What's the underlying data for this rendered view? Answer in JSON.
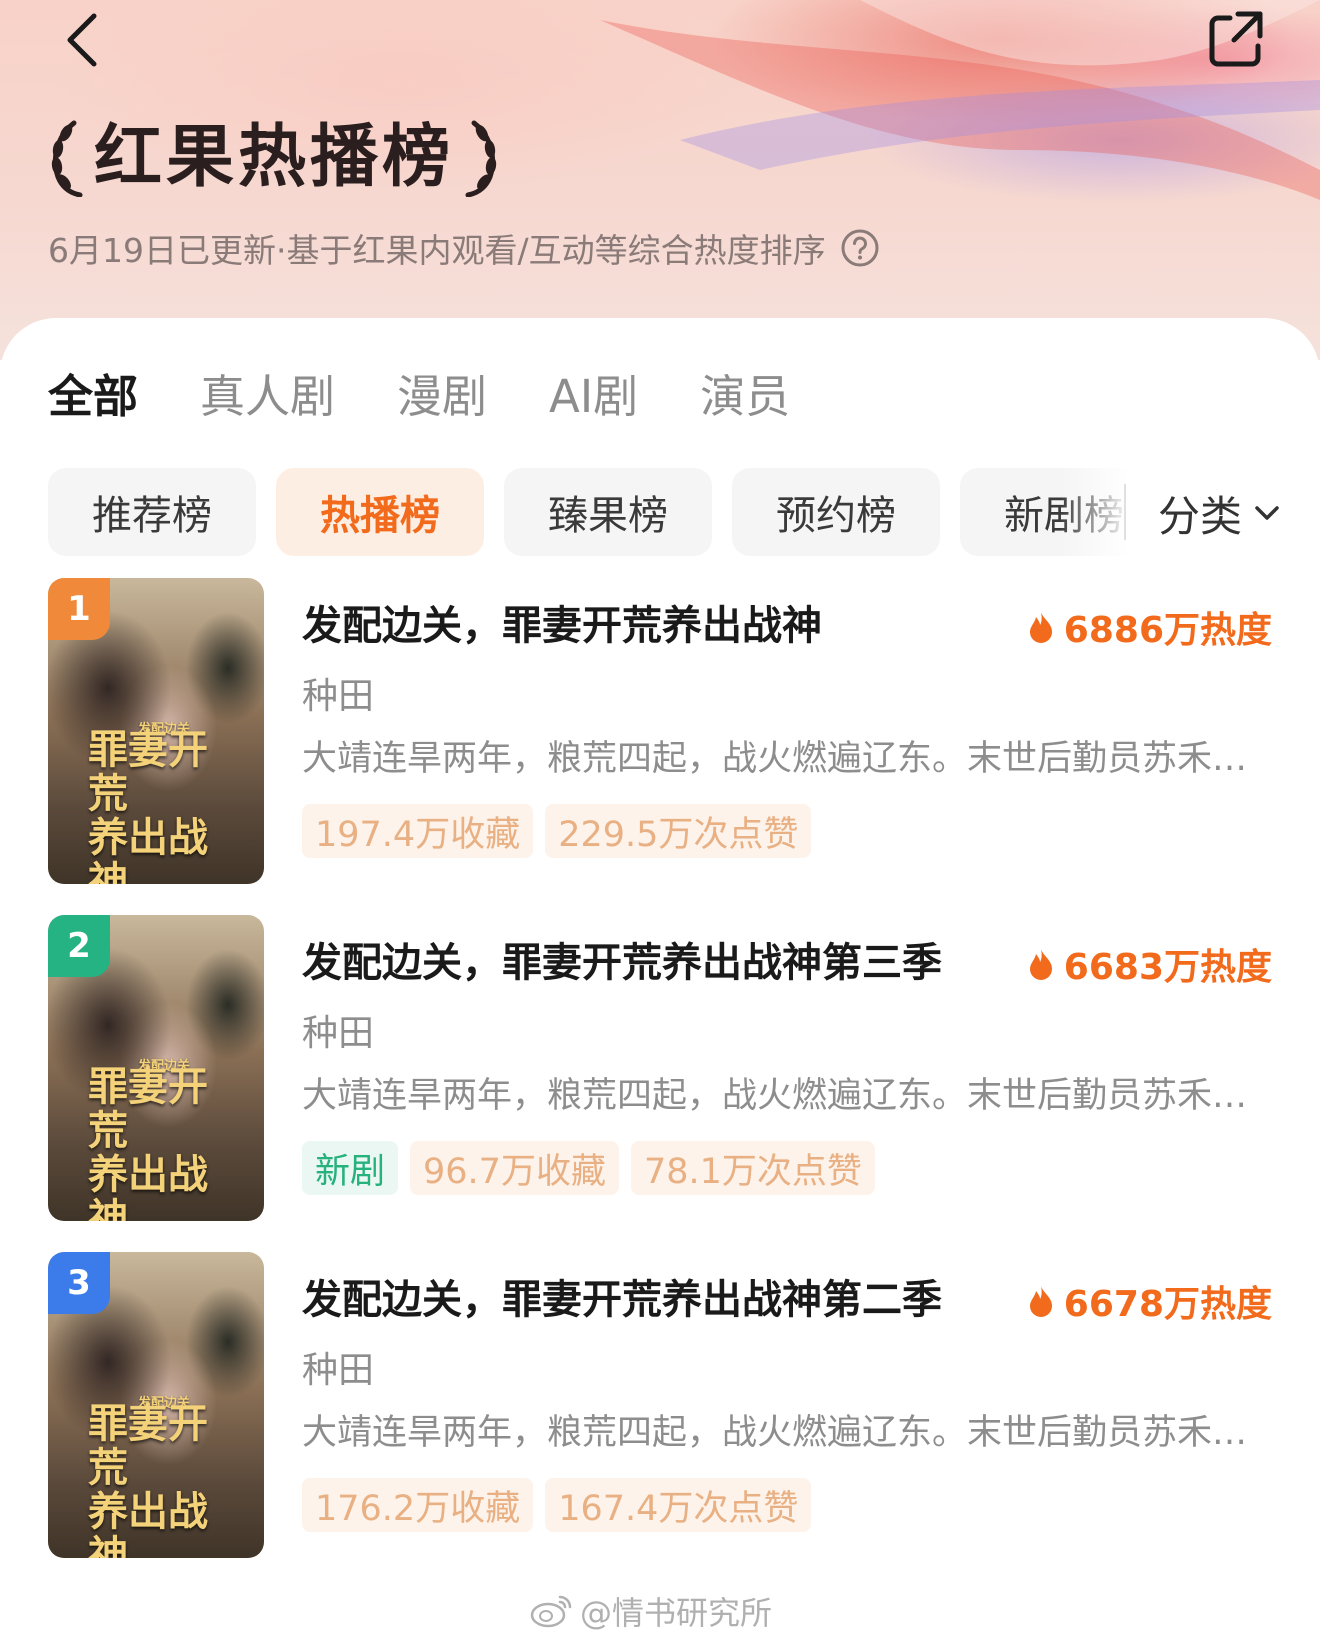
{
  "header": {
    "title": "红果热播榜",
    "subtitle": "6月19日已更新·基于红果内观看/互动等综合热度排序"
  },
  "main_tabs": [
    {
      "label": "全部",
      "active": true
    },
    {
      "label": "真人剧",
      "active": false
    },
    {
      "label": "漫剧",
      "active": false
    },
    {
      "label": "AI剧",
      "active": false
    },
    {
      "label": "演员",
      "active": false
    }
  ],
  "sub_tabs": [
    {
      "label": "推荐榜",
      "active": false
    },
    {
      "label": "热播榜",
      "active": true
    },
    {
      "label": "臻果榜",
      "active": false
    },
    {
      "label": "预约榜",
      "active": false
    },
    {
      "label": "新剧榜",
      "active": false
    }
  ],
  "category": {
    "label": "分类"
  },
  "dramas": [
    {
      "rank": "1",
      "rank_color": "#f08a3a",
      "title": "发配边关，罪妻开荒养出战神",
      "heat": "6886万热度",
      "genre": "种田",
      "description": "大靖连旱两年，粮荒四起，战火燃遍辽东。末世后勤员苏禾…",
      "tags": [
        {
          "text": "197.4万收藏",
          "kind": "stat"
        },
        {
          "text": "229.5万次点赞",
          "kind": "stat"
        }
      ]
    },
    {
      "rank": "2",
      "rank_color": "#25b383",
      "title": "发配边关，罪妻开荒养出战神第三季",
      "heat": "6683万热度",
      "genre": "种田",
      "description": "大靖连旱两年，粮荒四起，战火燃遍辽东。末世后勤员苏禾…",
      "tags": [
        {
          "text": "新剧",
          "kind": "new"
        },
        {
          "text": "96.7万收藏",
          "kind": "stat"
        },
        {
          "text": "78.1万次点赞",
          "kind": "stat"
        }
      ]
    },
    {
      "rank": "3",
      "rank_color": "#3b7bea",
      "title": "发配边关，罪妻开荒养出战神第二季",
      "heat": "6678万热度",
      "genre": "种田",
      "description": "大靖连旱两年，粮荒四起，战火燃遍辽东。末世后勤员苏禾…",
      "tags": [
        {
          "text": "176.2万收藏",
          "kind": "stat"
        },
        {
          "text": "167.4万次点赞",
          "kind": "stat"
        }
      ]
    }
  ],
  "cover": {
    "title_line1": "罪妻开荒",
    "title_line2": "养出战神",
    "small": "发配边关"
  },
  "watermark": "@情书研究所",
  "colors": {
    "accent": "#f26a1b",
    "new_green": "#27b17d",
    "tag_text": "#e8b083"
  }
}
